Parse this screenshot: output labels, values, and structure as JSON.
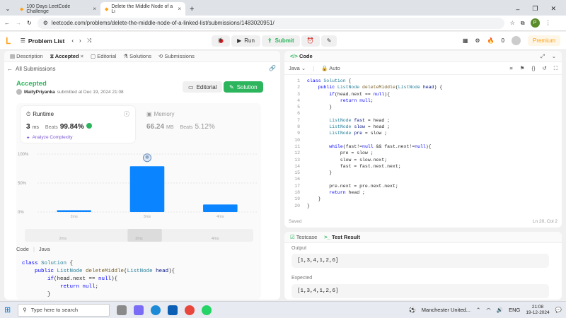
{
  "browser": {
    "tabs": [
      {
        "title": "100 Days LeetCode Challenge"
      },
      {
        "title": "Delete the Middle Node of a Li"
      }
    ],
    "url": "leetcode.com/problems/delete-the-middle-node-of-a-linked-list/submissions/1483020951/",
    "profile_initial": "P"
  },
  "nav": {
    "problem_list": "Problem List",
    "run": "Run",
    "submit": "Submit",
    "coins": "0",
    "premium": "Premium"
  },
  "left": {
    "tabs": [
      "Description",
      "Accepted",
      "Editorial",
      "Solutions",
      "Submissions"
    ],
    "back": "All Submissions",
    "status": "Accepted",
    "user": "MaityPriyanka",
    "submitted": "submitted at Dec 19, 2024 21:08",
    "editorial_btn": "Editorial",
    "solution_btn": "Solution",
    "runtime_label": "Runtime",
    "runtime_value": "3",
    "runtime_unit": "ms",
    "beats_label": "Beats",
    "beats_value": "99.84%",
    "analyze": "Analyze Complexity",
    "memory_label": "Memory",
    "memory_value": "66.24",
    "memory_unit": "MB",
    "mem_beats_label": "Beats",
    "mem_beats_value": "5.12%",
    "code_label": "Code",
    "code_lang": "Java",
    "code_preview": [
      [
        [
          "kw",
          "class "
        ],
        [
          "ty",
          "Solution "
        ],
        [
          "",
          "{"
        ]
      ],
      [
        [
          "",
          "    "
        ],
        [
          "kw",
          "public "
        ],
        [
          "ty",
          "ListNode "
        ],
        [
          "fn",
          "deleteMiddle"
        ],
        [
          "",
          "("
        ],
        [
          "ty",
          "ListNode "
        ],
        [
          "pa",
          "head"
        ],
        [
          "",
          "){"
        ]
      ],
      [
        [
          "",
          "        "
        ],
        [
          "kw",
          "if"
        ],
        [
          "",
          "(head.next == "
        ],
        [
          "kw",
          "null"
        ],
        [
          "",
          "){"
        ]
      ],
      [
        [
          "",
          "            "
        ],
        [
          "kw",
          "return "
        ],
        [
          "kw",
          "null"
        ],
        [
          "",
          ";"
        ]
      ],
      [
        [
          "",
          "        }"
        ]
      ]
    ]
  },
  "chart_data": {
    "type": "bar",
    "categories": [
      "2ms",
      "3ms",
      "4ms"
    ],
    "values": [
      3,
      79,
      13
    ],
    "ylim": [
      0,
      100
    ],
    "yticks": [
      "100%",
      "50%",
      "0%"
    ],
    "highlight": "3ms",
    "range_labels": [
      "2ms",
      "3ms",
      "4ms"
    ],
    "bar_color": "#0a84ff",
    "grid": true
  },
  "editor": {
    "title": "Code",
    "lang": "Java",
    "mode": "Auto",
    "saved": "Saved",
    "cursor": "Ln 20, Col 2",
    "lines": [
      [
        [
          "kw",
          "class "
        ],
        [
          "ty",
          "Solution "
        ],
        [
          "",
          "{"
        ]
      ],
      [
        [
          "",
          "    "
        ],
        [
          "kw",
          "public "
        ],
        [
          "ty",
          "ListNode "
        ],
        [
          "fn",
          "deleteMiddle"
        ],
        [
          "",
          "("
        ],
        [
          "ty",
          "ListNode "
        ],
        [
          "pa",
          "head"
        ],
        [
          "",
          ") {"
        ]
      ],
      [
        [
          "",
          "        "
        ],
        [
          "kw",
          "if"
        ],
        [
          "",
          "(head.next == "
        ],
        [
          "kw",
          "null"
        ],
        [
          "",
          "){"
        ]
      ],
      [
        [
          "",
          "            "
        ],
        [
          "kw",
          "return "
        ],
        [
          "kw",
          "null"
        ],
        [
          "",
          ";"
        ]
      ],
      [
        [
          "",
          "        }"
        ]
      ],
      [
        [
          "",
          ""
        ]
      ],
      [
        [
          "",
          "        "
        ],
        [
          "ty",
          "ListNode "
        ],
        [
          "pa",
          "fast"
        ],
        [
          "",
          " = head ;"
        ]
      ],
      [
        [
          "",
          "        "
        ],
        [
          "ty",
          "ListNode "
        ],
        [
          "pa",
          "slow"
        ],
        [
          "",
          " = head ;"
        ]
      ],
      [
        [
          "",
          "        "
        ],
        [
          "ty",
          "ListNode "
        ],
        [
          "pa",
          "pre"
        ],
        [
          "",
          " = slow ;"
        ]
      ],
      [
        [
          "",
          ""
        ]
      ],
      [
        [
          "",
          "        "
        ],
        [
          "kw",
          "while"
        ],
        [
          "",
          "(fast!="
        ],
        [
          "kw",
          "null"
        ],
        [
          "",
          " && fast.next!="
        ],
        [
          "kw",
          "null"
        ],
        [
          "",
          "){"
        ]
      ],
      [
        [
          "",
          "            pre = slow ;"
        ]
      ],
      [
        [
          "",
          "            slow = slow.next;"
        ]
      ],
      [
        [
          "",
          "            fast = fast.next.next;"
        ]
      ],
      [
        [
          "",
          "        }"
        ]
      ],
      [
        [
          "",
          ""
        ]
      ],
      [
        [
          "",
          "        pre.next = pre.next.next;"
        ]
      ],
      [
        [
          "",
          "        "
        ],
        [
          "kw",
          "return "
        ],
        [
          "",
          "head ;"
        ]
      ],
      [
        [
          "",
          "    }"
        ]
      ],
      [
        [
          "",
          "}"
        ]
      ]
    ]
  },
  "result": {
    "testcase_tab": "Testcase",
    "result_tab": "Test Result",
    "output_label": "Output",
    "output_value": "[1,3,4,1,2,6]",
    "expected_label": "Expected",
    "expected_value": "[1,3,4,1,2,6]"
  },
  "taskbar": {
    "search": "Type here to search",
    "weather": "Manchester United...",
    "lang": "ENG",
    "time": "21:08",
    "date": "19-12-2024"
  }
}
